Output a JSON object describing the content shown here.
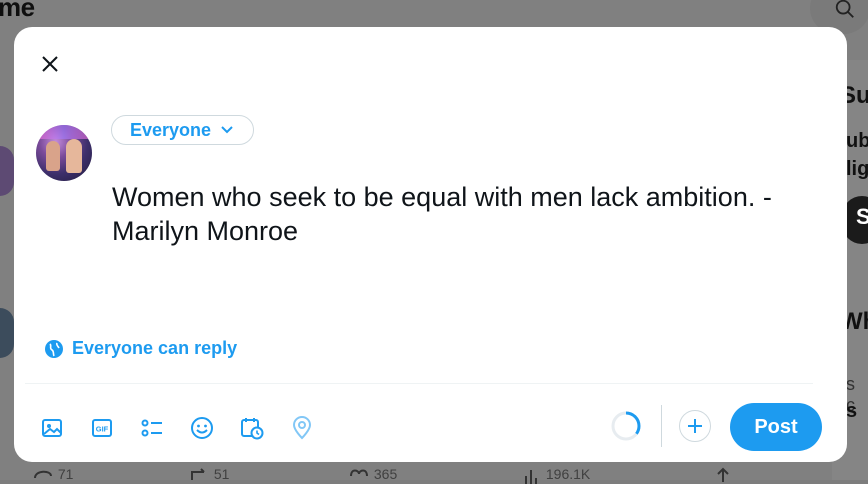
{
  "background": {
    "page_title_fragment": "me",
    "right_fragments": [
      "Su",
      "ub",
      "lig",
      "S",
      "Wh",
      "s c",
      "s"
    ],
    "actions": [
      {
        "icon": "reply-icon",
        "count": "71"
      },
      {
        "icon": "repost-icon",
        "count": "51"
      },
      {
        "icon": "like-icon",
        "count": "365"
      },
      {
        "icon": "views-icon",
        "count": "196.1K"
      },
      {
        "icon": "share-icon",
        "count": ""
      }
    ]
  },
  "composer": {
    "audience_label": "Everyone",
    "text": "Women who seek to be equal with men lack ambition. -\nMarilyn Monroe",
    "reply_setting": "Everyone can reply",
    "post_label": "Post",
    "toolbar_icons": [
      "media-icon",
      "gif-icon",
      "poll-icon",
      "emoji-icon",
      "schedule-icon",
      "location-icon"
    ],
    "char_progress": 0.35
  },
  "colors": {
    "accent": "#1d9bf0",
    "text": "#0f1419",
    "border": "#cfd9de",
    "overlay": "#808080"
  }
}
